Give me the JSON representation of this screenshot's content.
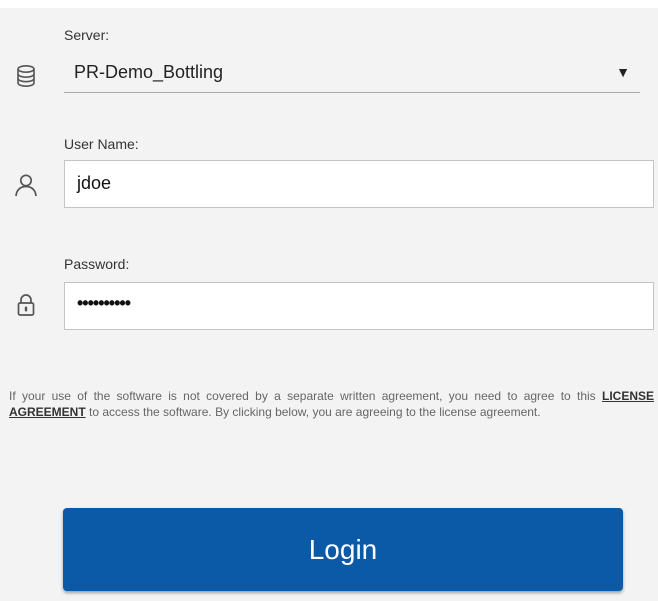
{
  "colors": {
    "background": "#f3f3f3",
    "button": "#0b5aa8",
    "button_text": "#ffffff"
  },
  "server": {
    "label": "Server:",
    "selected": "PR-Demo_Bottling",
    "arrow": "▼",
    "icon": "database-icon"
  },
  "username": {
    "label": "User Name:",
    "value": "jdoe",
    "icon": "user-icon"
  },
  "password": {
    "label": "Password:",
    "masked_value": "••••••••••",
    "icon": "lock-icon"
  },
  "license": {
    "text_before": "If your use of the software is not covered by a separate written agreement, you need to agree to this ",
    "link_text": "LICENSE AGREEMENT",
    "text_after": " to access the software. By clicking below, you are agreeing to the license agreement."
  },
  "login": {
    "label": "Login"
  }
}
